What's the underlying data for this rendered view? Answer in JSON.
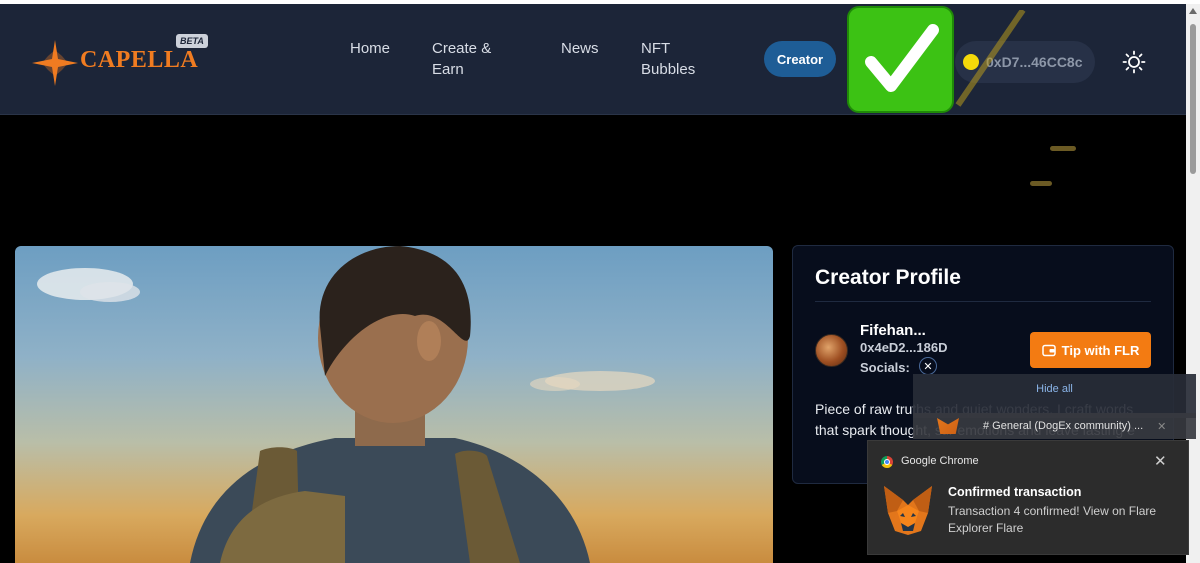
{
  "header": {
    "logo_text": "CAPELLA",
    "beta_label": "BETA",
    "nav": [
      {
        "label": "Home"
      },
      {
        "label": "Create &\nEarn"
      },
      {
        "label": "News"
      },
      {
        "label": "NFT\nBubbles"
      }
    ],
    "creator_button": "Creator",
    "wallet_address": "0xD7...46CC8c",
    "icons": {
      "logo": "star-burst-icon",
      "check": "check-mark-icon",
      "coin": "coin-icon",
      "theme": "sun-icon"
    }
  },
  "profile": {
    "title": "Creator Profile",
    "name": "Fifehan...",
    "address": "0x4eD2...186D",
    "socials_label": "Socials:",
    "socials_icon": "x-icon",
    "tip_button": "Tip with FLR",
    "bio": "Piece of raw truths and quiet wonders. I craft words that spark thought, stir emotions and leave lasting e"
  },
  "notifications": {
    "hide_all": "Hide all",
    "group_label": "# General (DogEx community) ...",
    "toast": {
      "app": "Google Chrome",
      "title": "Confirmed transaction",
      "body": "Transaction 4 confirmed! View on Flare Explorer Flare",
      "close_icon": "close-icon"
    }
  },
  "colors": {
    "header_bg": "#1c2538",
    "accent_orange": "#f37b12",
    "creator_blue": "#1e5d96",
    "check_green": "#3cc214"
  }
}
